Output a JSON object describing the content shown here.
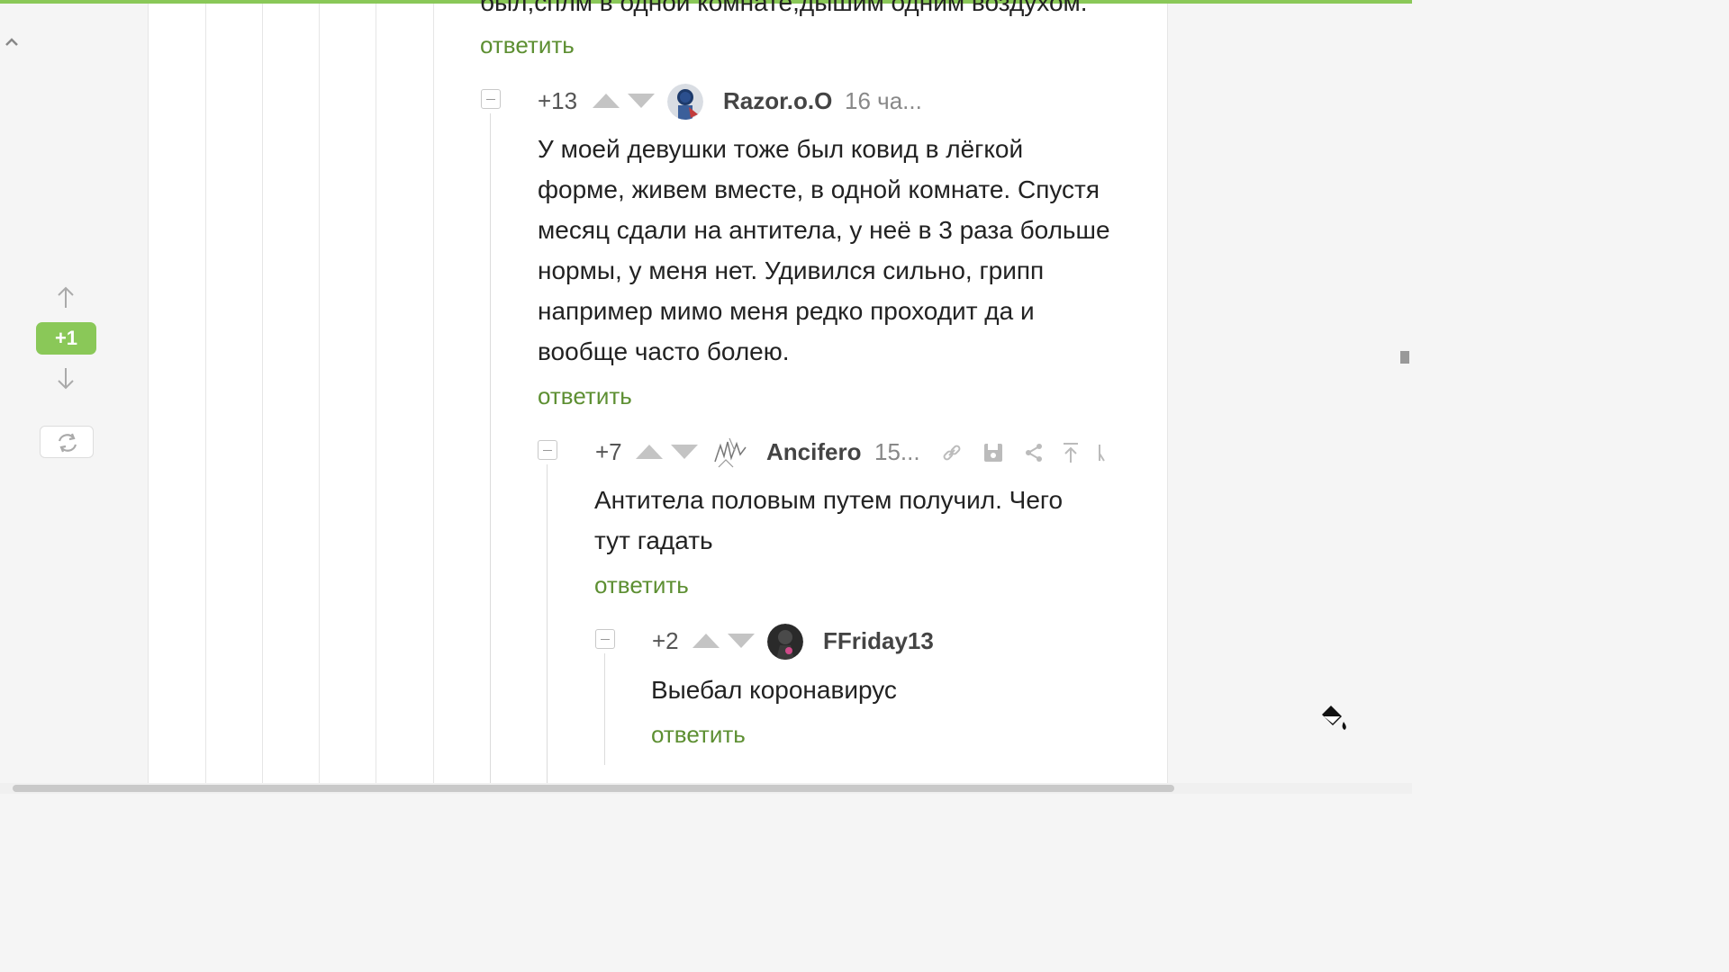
{
  "page": {
    "accent": "#8ac858",
    "link_color": "#5d8f32"
  },
  "sidebar": {
    "rating": "+1",
    "icons": {
      "collapse": "chevron-up-icon",
      "up": "arrow-up-icon",
      "down": "arrow-down-icon",
      "refresh": "refresh-icon"
    }
  },
  "comments": [
    {
      "id": "c0",
      "text_partial": "был,сплм в одной комнате,дышим одним воздухом.",
      "reply_label": "ответить"
    },
    {
      "id": "c1",
      "score": "+13",
      "username": "Razor.o.O",
      "time": "16 ча...",
      "lines": [
        "У моей девушки тоже был ковид в лёгкой",
        "форме, живем вместе, в одной комнате. Спустя",
        "месяц сдали на антитела, у неё в 3 раза больше",
        "нормы, у меня нет. Удивился сильно, грипп",
        "например мимо меня редко проходит да и",
        "вообще часто болею."
      ],
      "reply_label": "ответить"
    },
    {
      "id": "c2",
      "score": "+7",
      "username": "Ancifero",
      "time": "15...",
      "lines": [
        "Антитела половым путем получил. Чего",
        "тут гадать"
      ],
      "reply_label": "ответить",
      "tools": [
        "link-icon",
        "save-icon",
        "share-icon",
        "scroll-to-top-icon",
        "more-icon"
      ]
    },
    {
      "id": "c3",
      "score": "+2",
      "username": "FFriday13",
      "lines": [
        "Выебал коронавирус"
      ],
      "reply_label": "ответить"
    }
  ],
  "floating": {
    "paint_icon": "paint-bucket-icon"
  }
}
